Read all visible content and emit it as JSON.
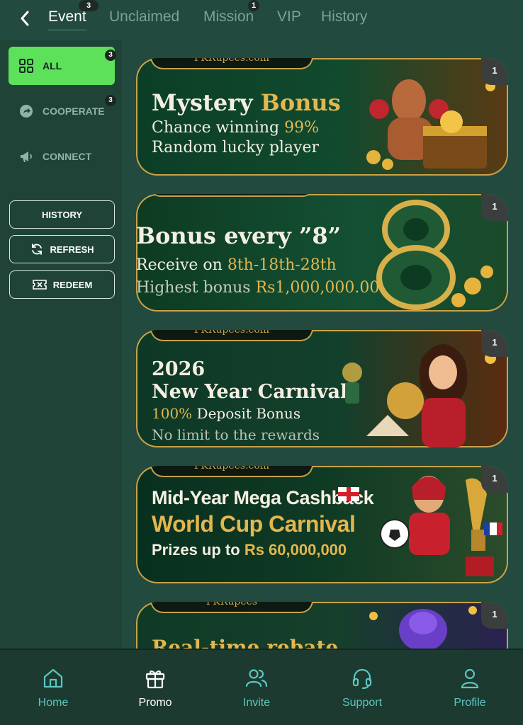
{
  "tabs": [
    {
      "label": "Event",
      "badge": "3"
    },
    {
      "label": "Unclaimed"
    },
    {
      "label": "Mission",
      "badge": "1"
    },
    {
      "label": "VIP"
    },
    {
      "label": "History"
    }
  ],
  "sidebar": {
    "categories": [
      {
        "label": "ALL",
        "badge": "3",
        "icon": "grid-icon"
      },
      {
        "label": "COOPERATE",
        "badge": "3",
        "icon": "share-icon"
      },
      {
        "label": "CONNECT",
        "icon": "megaphone-icon"
      }
    ],
    "buttons": [
      {
        "label": "HISTORY"
      },
      {
        "label": "REFRESH",
        "icon": "refresh-icon"
      },
      {
        "label": "REDEEM",
        "icon": "ticket-icon"
      }
    ]
  },
  "banners": [
    {
      "badge": "1",
      "brand": "PKRupees.com",
      "lines": [
        "Mystery",
        "Bonus",
        "Chance winning",
        "99%",
        "Random lucky player"
      ]
    },
    {
      "badge": "1",
      "lines": [
        "Bonus every ”8”",
        "Receive on",
        "8th-18th-28th",
        "Highest bonus",
        "Rs1,000,000.00"
      ]
    },
    {
      "badge": "1",
      "brand": "PKRupees.com",
      "lines": [
        "2026",
        "New Year Carnival",
        "100%",
        "Deposit Bonus",
        "No limit to the rewards"
      ]
    },
    {
      "badge": "1",
      "brand": "PKRupees.com",
      "lines": [
        "Mid-Year Mega Cashback",
        "World Cup Carnival",
        "Prizes up to",
        "Rs 60,000,000"
      ]
    },
    {
      "badge": "1",
      "brand": "PKRupees",
      "lines": [
        "Real-time rebate"
      ]
    }
  ],
  "bottom_nav": [
    {
      "label": "Home",
      "icon": "home-icon"
    },
    {
      "label": "Promo",
      "icon": "gift-icon"
    },
    {
      "label": "Invite",
      "icon": "users-icon"
    },
    {
      "label": "Support",
      "icon": "headset-icon"
    },
    {
      "label": "Profile",
      "icon": "profile-icon"
    }
  ],
  "colors": {
    "accent": "#5de05a",
    "gold": "#e3b64f",
    "background": "#234a3e",
    "nav_icon": "#5cc7c0"
  }
}
